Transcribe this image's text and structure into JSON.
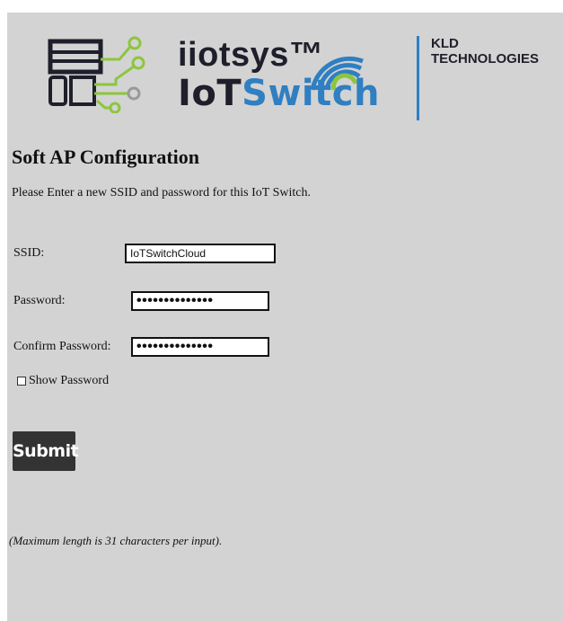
{
  "logo": {
    "brand_top": "iiotsys™",
    "brand_iot": "IoT",
    "brand_switch": "Switch",
    "company_line1": "KLD",
    "company_line2": "TECHNOLOGIES"
  },
  "form": {
    "title": "Soft AP Configuration",
    "intro": "Please Enter a new SSID and password for this IoT Switch.",
    "ssid_label": "SSID:",
    "ssid_value": "IoTSwitchCloud",
    "password_label": "Password:",
    "password_mask": "••••••••••••••",
    "confirm_label": "Confirm Password:",
    "confirm_mask": "••••••••••••••",
    "show_password_label": "Show Password",
    "show_password_checked": false,
    "submit_label": "Submit",
    "note": "(Maximum length is 31 characters per input)."
  },
  "colors": {
    "panel_bg": "#d3d3d3",
    "brand_blue": "#2f7fc1",
    "brand_green": "#8cc63f",
    "button_bg": "#333333"
  }
}
